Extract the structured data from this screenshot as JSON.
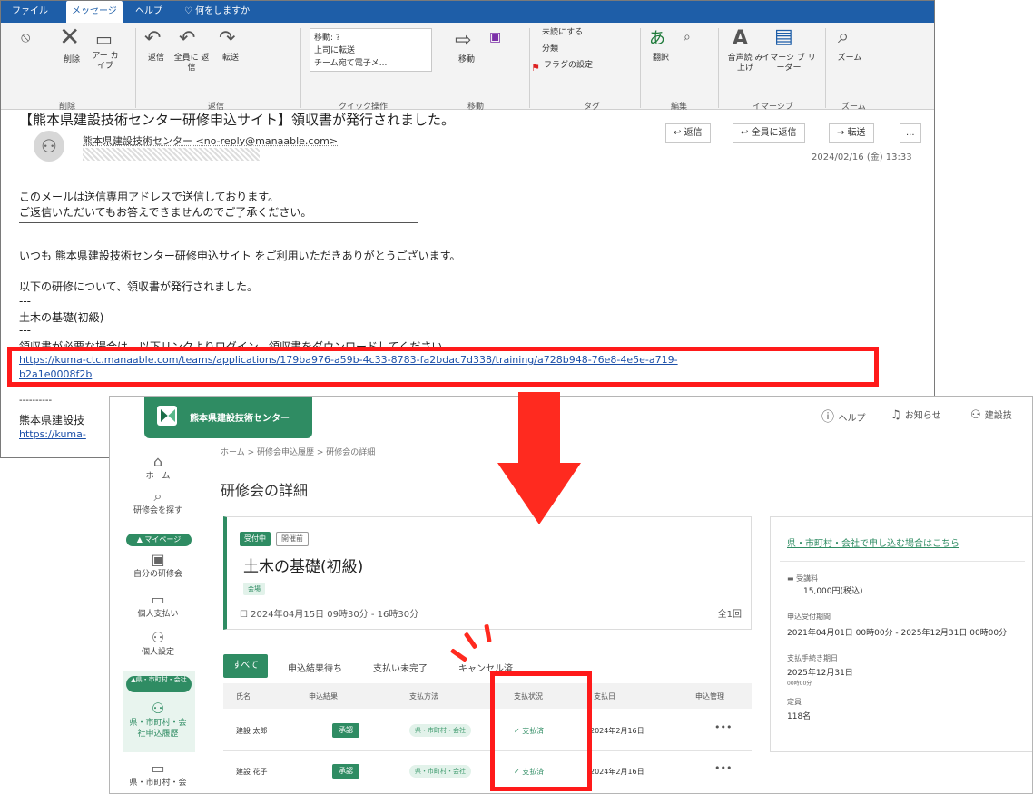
{
  "outlook": {
    "menu": [
      "ファイル",
      "メッセージ",
      "ヘルプ",
      "♡ 何をしますか"
    ],
    "ribbon": {
      "delete_label": "削除",
      "archive_label": "アー カイブ",
      "reply_label": "返信",
      "reply_all_label": "全員に 返信",
      "forward_label": "転送",
      "quick_move": "移動: ?",
      "quick_forward_boss": "上司に転送",
      "quick_team_email": "チーム宛て電子メ...",
      "move_label": "移動",
      "unread_label": "未読にする",
      "categorize_label": "分類",
      "flag_label": "フラグの設定",
      "translate_label": "翻訳",
      "read_aloud_label": "音声読 み上げ",
      "immersive_label": "イマーシ ブ リーダー",
      "zoom_label": "ズーム",
      "groups": [
        "削除",
        "返信",
        "クイック操作",
        "移動",
        "タグ",
        "編集",
        "イマーシブ",
        "ズーム"
      ]
    },
    "subject": "【熊本県建設技術センター研修申込サイト】領収書が発行されました。",
    "sender": "熊本県建設技術センター <no-reply@manaable.com>",
    "actions": {
      "reply": "返信",
      "reply_all": "全員に返信",
      "forward": "転送",
      "more": "..."
    },
    "datetime": "2024/02/16 (金) 13:33",
    "body": [
      "このメールは送信専用アドレスで送信しております。",
      "ご返信いただいてもお答えできませんのでご了承ください。",
      "いつも 熊本県建設技術センター研修申込サイト をご利用いただきありがとうございます。",
      "以下の研修について、領収書が発行されました。",
      "---",
      "土木の基礎(初級)",
      "---",
      "領収書が必要な場合は、以下リンクよりログイン、領収書をダウンロードしてください。"
    ],
    "link_line1": "https://kuma-ctc.manaable.com/teams/applications/179ba976-a59b-4c33-8783-fa2bdac7d338/training/a728b948-76e8-4e5e-a719-",
    "link_line2": "b2a1e0008f2b",
    "footer_dashes": "----------",
    "footer_org": "熊本県建設技",
    "footer_link": "https://kuma-"
  },
  "webapp": {
    "logo_text": "熊本県建設技術センター",
    "help": "ヘルプ",
    "notifications": "お知らせ",
    "user": "建設技",
    "breadcrumb": "ホーム > 研修会申込履歴 > 研修会の詳細",
    "page_title": "研修会の詳細",
    "nav": {
      "home": "ホーム",
      "search": "研修会を探す",
      "my_page": "▲ マイページ",
      "my_trainings": "自分の研修会",
      "personal_payment": "個人支払い",
      "personal_settings": "個人設定",
      "org_section": "▲県・市町村・会社",
      "org_history": "県・市町村・会 社申込履歴",
      "org_more": "県・市町村・会"
    },
    "course": {
      "status": "受付中",
      "held_status": "開催前",
      "name": "土木の基礎(初級)",
      "tag": "会場",
      "date": "2024年04月15日 09時30分 - 16時30分",
      "sessions": "全1回"
    },
    "side": {
      "org_link": "県・市町村・会社で申し込む場合はこちら",
      "fee_label": "受講料",
      "fee_value": "15,000円(税込)",
      "period_label": "申込受付期間",
      "period_value": "2021年04月01日 00時00分 - 2025年12月31日 00時00分",
      "deadline_label": "支払手続き期日",
      "deadline_value": "2025年12月31日",
      "deadline_time": "00時00分",
      "capacity_label": "定員",
      "capacity_value": "118名"
    },
    "tabs": [
      "すべて",
      "申込結果待ち",
      "支払い未完了",
      "キャンセル済"
    ],
    "table": {
      "headers": [
        "氏名",
        "申込結果",
        "支払方法",
        "支払状況",
        "支払日",
        "申込管理"
      ],
      "rows": [
        {
          "name": "建設 太郎",
          "result": "承認",
          "method": "県・市町村・会社",
          "status": "✓ 支払済",
          "date": "2024年2月16日",
          "menu": "•••"
        },
        {
          "name": "建設 花子",
          "result": "承認",
          "method": "県・市町村・会社",
          "status": "✓ 支払済",
          "date": "2024年2月16日",
          "menu": "•••"
        }
      ]
    }
  },
  "colors": {
    "accent_green": "#2f8c63",
    "highlight_red": "#ff1a1a",
    "outlook_blue": "#1e5ea8"
  },
  "icons": [
    "delete-icon",
    "archive-icon",
    "reply-icon",
    "reply-all-icon",
    "forward-icon",
    "move-icon",
    "flag-icon",
    "translate-icon",
    "read-aloud-icon",
    "zoom-icon",
    "help-icon",
    "bell-icon",
    "user-icon",
    "home-icon",
    "search-icon",
    "calendar-icon",
    "card-icon",
    "person-icon",
    "group-icon"
  ]
}
